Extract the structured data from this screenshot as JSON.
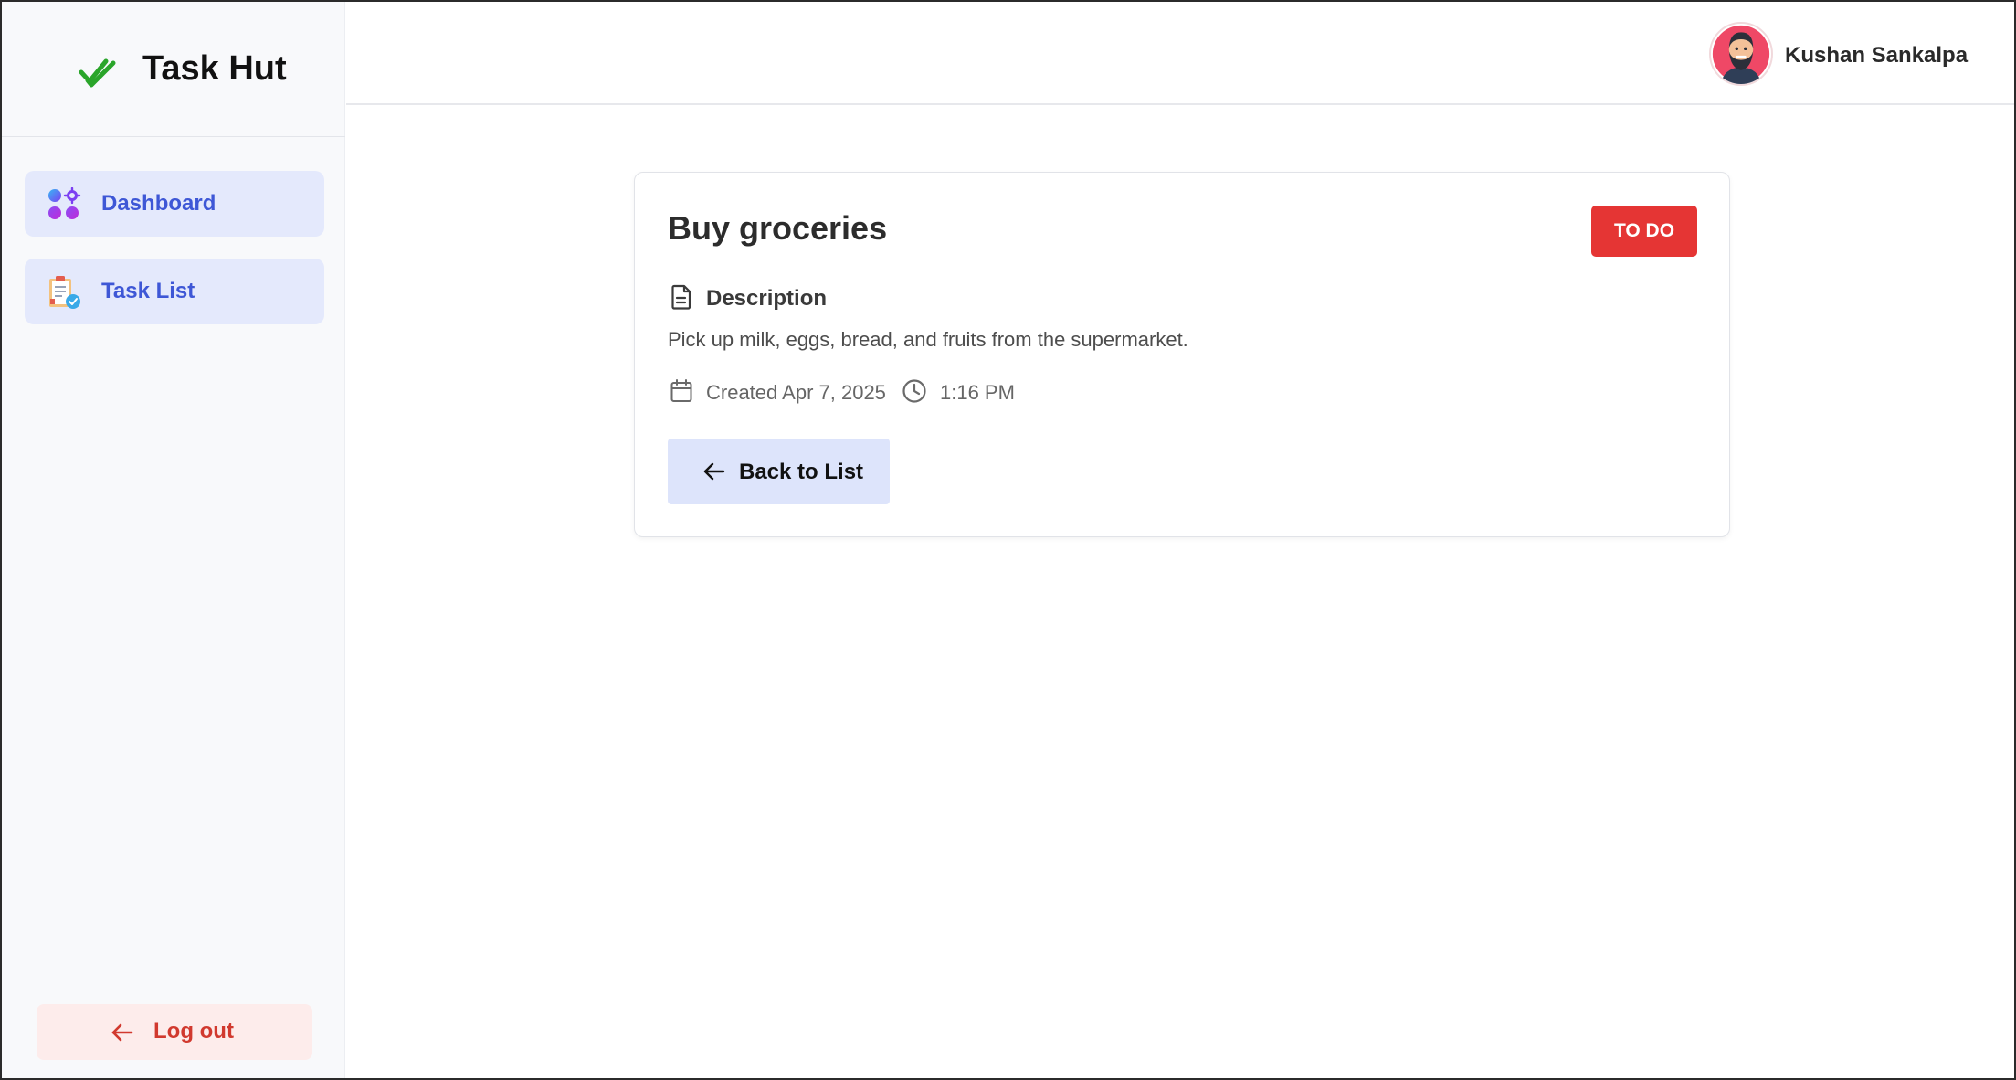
{
  "app": {
    "name": "Task Hut",
    "brand_icon": "double-check-icon",
    "brand_color": "#2aa52a"
  },
  "sidebar": {
    "items": [
      {
        "label": "Dashboard",
        "icon": "dashboard-icon"
      },
      {
        "label": "Task List",
        "icon": "task-list-icon"
      }
    ],
    "logout": {
      "label": "Log out",
      "icon": "arrow-left-icon"
    }
  },
  "header": {
    "user_name": "Kushan Sankalpa",
    "avatar_icon": "user-avatar"
  },
  "task": {
    "title": "Buy groceries",
    "status": "TO DO",
    "status_color": "#e53534",
    "description_heading": "Description",
    "description": "Pick up milk, eggs, bread, and fruits from the supermarket.",
    "created": "Created Apr 7, 2025",
    "time": "1:16 PM",
    "back_label": "Back to List"
  },
  "colors": {
    "accent": "#3e57d6",
    "nav_bg": "#e4e9fc",
    "logout_text": "#d1392e",
    "logout_bg": "#fdeceb"
  }
}
